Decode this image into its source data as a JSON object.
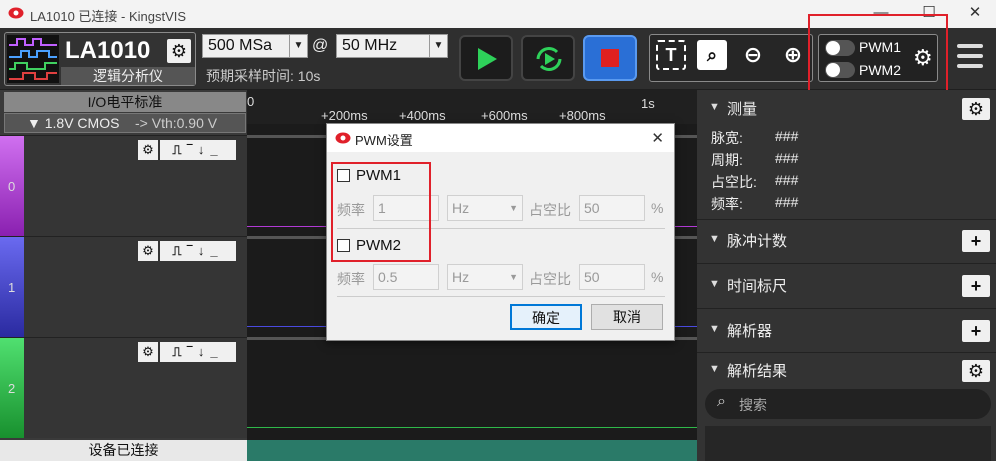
{
  "window": {
    "title": "LA1010 已连接 - KingstVIS",
    "minimize": "—",
    "maximize": "☐",
    "close": "✕"
  },
  "device": {
    "name": "LA1010",
    "subtitle": "逻辑分析仪",
    "icon": "logic-analyzer-icon"
  },
  "sampling": {
    "depth": "500 MSa",
    "at": "@",
    "rate": "50 MHz",
    "expected_time": "预期采样时间: 10s"
  },
  "pwm_toggles": [
    {
      "label": "PWM1",
      "on": false
    },
    {
      "label": "PWM2",
      "on": false
    }
  ],
  "left": {
    "io_title": "I/O电平标准",
    "io_level": "▼ 1.8V CMOS",
    "vth": "-> Vth:0.90 V",
    "status": "设备已连接",
    "channels": [
      {
        "num": "0",
        "color": "#b23ad6"
      },
      {
        "num": "1",
        "color": "#3b3fcf"
      },
      {
        "num": "2",
        "color": "#2fb84a"
      }
    ]
  },
  "timeline": {
    "zero": "0",
    "ticks": [
      "+200ms",
      "+400ms",
      "+600ms",
      "+800ms"
    ],
    "end": "1s"
  },
  "right": {
    "measure": {
      "title": "测量",
      "rows": [
        {
          "k": "脉宽:",
          "v": "###"
        },
        {
          "k": "周期:",
          "v": "###"
        },
        {
          "k": "占空比:",
          "v": "###"
        },
        {
          "k": "频率:",
          "v": "###"
        }
      ]
    },
    "pulse_count": "脉冲计数",
    "time_ruler": "时间标尺",
    "analyzer": "解析器",
    "results": "解析结果",
    "search_placeholder": "搜索"
  },
  "dialog": {
    "title": "PWM设置",
    "close": "✕",
    "pwm1": {
      "label": "PWM1",
      "freq_label": "频率",
      "freq": "1",
      "unit": "Hz",
      "duty_label": "占空比",
      "duty": "50",
      "pct": "%"
    },
    "pwm2": {
      "label": "PWM2",
      "freq_label": "频率",
      "freq": "0.5",
      "unit": "Hz",
      "duty_label": "占空比",
      "duty": "50",
      "pct": "%"
    },
    "ok": "确定",
    "cancel": "取消"
  }
}
